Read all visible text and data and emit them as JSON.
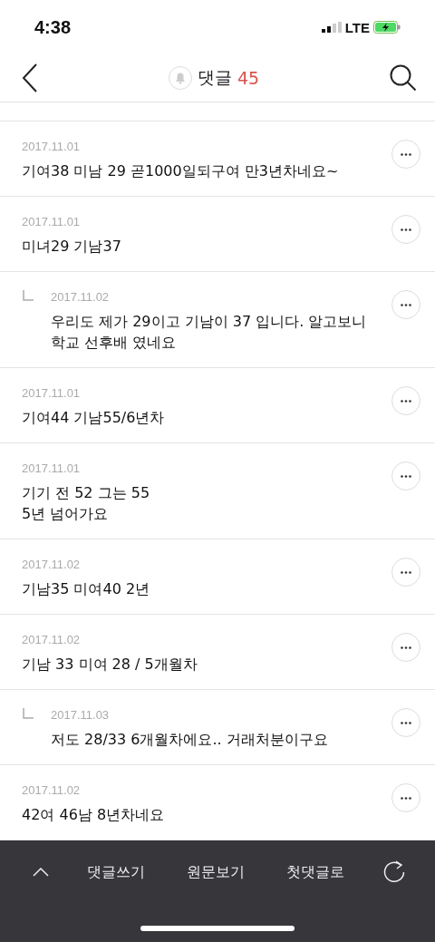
{
  "status_bar": {
    "time": "4:38",
    "network": "LTE"
  },
  "header": {
    "title": "댓글",
    "count": "45"
  },
  "comments": [
    {
      "kind": "comment",
      "date": "2017.11.01",
      "text": "기여38 미남 29 곧1000일되구여 만3년차네요~"
    },
    {
      "kind": "comment",
      "date": "2017.11.01",
      "text": "미녀29 기남37"
    },
    {
      "kind": "reply",
      "date": "2017.11.02",
      "text": "우리도 제가 29이고 기남이 37 입니다. 알고보니 학교 선후배 였네요"
    },
    {
      "kind": "comment",
      "date": "2017.11.01",
      "text": "기여44 기남55/6년차"
    },
    {
      "kind": "comment",
      "date": "2017.11.01",
      "text": "기기 전 52 그는 55\n5년 넘어가요"
    },
    {
      "kind": "comment",
      "date": "2017.11.02",
      "text": "기남35 미여40 2년"
    },
    {
      "kind": "comment",
      "date": "2017.11.02",
      "text": "기남 33 미여 28 / 5개월차"
    },
    {
      "kind": "reply",
      "date": "2017.11.03",
      "text": "저도 28/33 6개월차에요.. 거래처분이구요"
    },
    {
      "kind": "comment",
      "date": "2017.11.02",
      "text": "42여 46남 8년차네요"
    }
  ],
  "bottom_bar": {
    "actions": [
      "댓글쓰기",
      "원문보기",
      "첫댓글로"
    ]
  }
}
